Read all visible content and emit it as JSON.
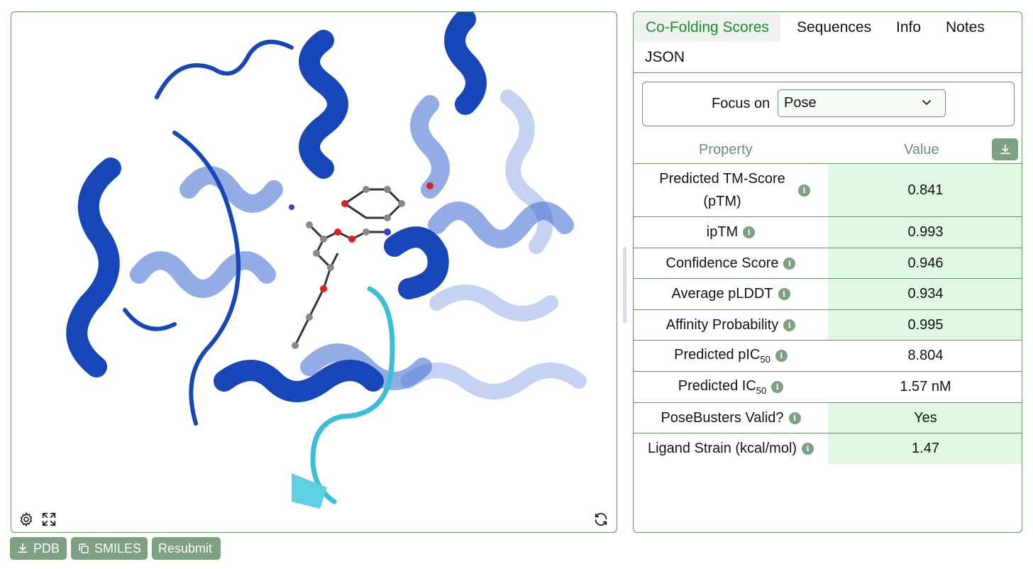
{
  "viewer": {
    "icons": [
      "gear-icon",
      "fullscreen-icon",
      "refresh-icon"
    ]
  },
  "actions": {
    "pdb_label": "PDB",
    "smiles_label": "SMILES",
    "resubmit_label": "Resubmit"
  },
  "tabs": {
    "cofolding": "Co-Folding Scores",
    "sequences": "Sequences",
    "info": "Info",
    "notes": "Notes",
    "json": "JSON"
  },
  "focus": {
    "label": "Focus on",
    "selected": "Pose"
  },
  "table": {
    "header_property": "Property",
    "header_value": "Value",
    "rows": [
      {
        "property": "Predicted TM-Score (pTM)",
        "value": "0.841",
        "highlight": true
      },
      {
        "property": "ipTM",
        "value": "0.993",
        "highlight": true
      },
      {
        "property": "Confidence Score",
        "value": "0.946",
        "highlight": true
      },
      {
        "property": "Average pLDDT",
        "value": "0.934",
        "highlight": true
      },
      {
        "property": "Affinity Probability",
        "value": "0.995",
        "highlight": true
      },
      {
        "property_main": "Predicted pIC",
        "property_sub": "50",
        "value": "8.804",
        "highlight": false
      },
      {
        "property_main": "Predicted IC",
        "property_sub": "50",
        "value": "1.57 nM",
        "highlight": false
      },
      {
        "property": "PoseBusters Valid?",
        "value": "Yes",
        "highlight": true
      },
      {
        "property": "Ligand Strain (kcal/mol)",
        "value": "1.47",
        "highlight": true
      }
    ]
  },
  "colors": {
    "accent": "#7d9f82",
    "border": "#6b8f6b",
    "active_tab_text": "#1f8a2f",
    "good_cell": "#dff7e3",
    "protein_blue": "#1646b8",
    "loop_cyan": "#3cbfd6"
  }
}
